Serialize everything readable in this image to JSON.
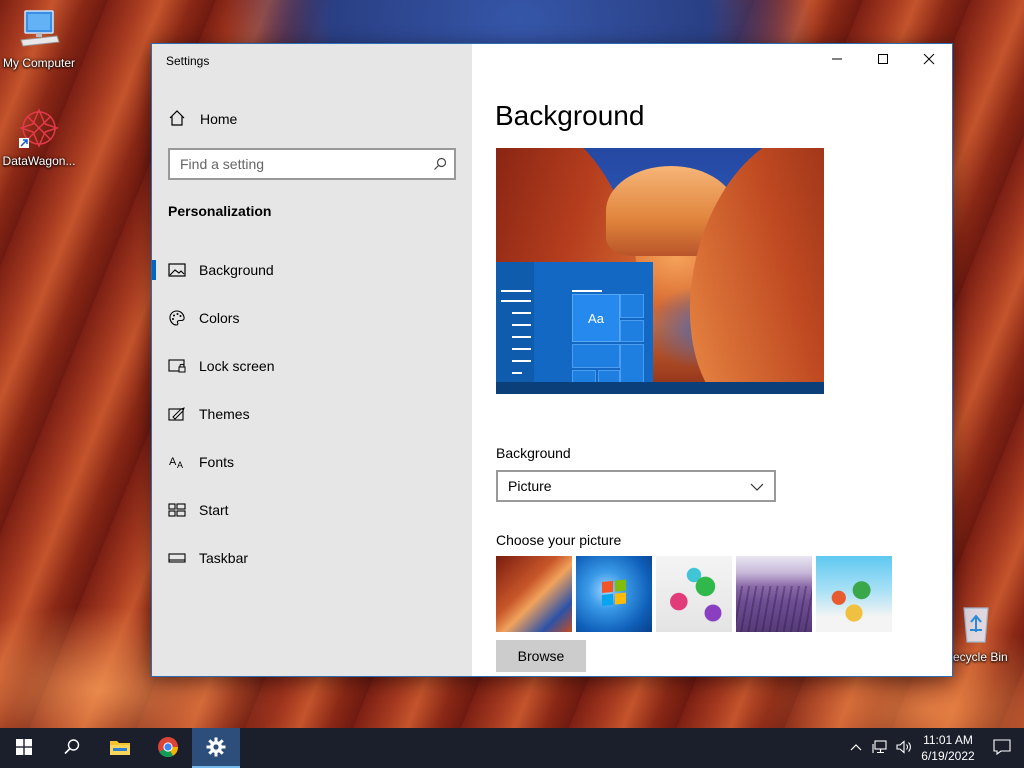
{
  "desktop": {
    "icons": [
      {
        "label": "My Computer"
      },
      {
        "label": "DataWagon..."
      },
      {
        "label": "Recycle Bin"
      }
    ]
  },
  "window": {
    "app_title": "Settings",
    "nav": {
      "home_label": "Home",
      "search_placeholder": "Find a setting",
      "section_title": "Personalization",
      "items": [
        {
          "label": "Background",
          "icon": "picture-icon",
          "active": true
        },
        {
          "label": "Colors",
          "icon": "palette-icon",
          "active": false
        },
        {
          "label": "Lock screen",
          "icon": "lock-screen-icon",
          "active": false
        },
        {
          "label": "Themes",
          "icon": "themes-icon",
          "active": false
        },
        {
          "label": "Fonts",
          "icon": "fonts-icon",
          "active": false
        },
        {
          "label": "Start",
          "icon": "start-icon",
          "active": false
        },
        {
          "label": "Taskbar",
          "icon": "taskbar-icon",
          "active": false
        }
      ]
    },
    "content": {
      "page_title": "Background",
      "preview_tile_text": "Aa",
      "background_label": "Background",
      "background_value": "Picture",
      "choose_picture_label": "Choose your picture",
      "browse_label": "Browse"
    }
  },
  "taskbar": {
    "time": "11:01 AM",
    "date": "6/19/2022"
  },
  "colors": {
    "accent": "#0067c0",
    "nav_background": "#e6e6e6",
    "taskbar": "#1a1f2b"
  }
}
